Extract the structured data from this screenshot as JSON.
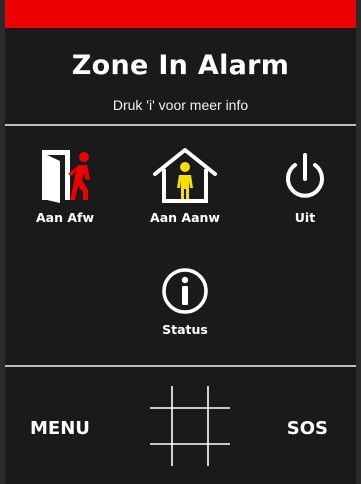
{
  "header": {
    "title": "Zone In Alarm",
    "subtitle": "Druk 'i' voor meer info",
    "alarm_color": "#ee0000"
  },
  "actions": [
    {
      "label": "Aan Afw",
      "icon": "door-walking-person-icon"
    },
    {
      "label": "Aan Aanw",
      "icon": "house-person-icon"
    },
    {
      "label": "Uit",
      "icon": "power-icon"
    },
    {
      "label": "Status",
      "icon": "info-icon"
    }
  ],
  "footer": {
    "menu_label": "MENU",
    "sos_label": "SOS",
    "keypad_icon": "keypad-grid-icon"
  },
  "colors": {
    "background": "#1a1a1a",
    "text": "#ffffff",
    "person_away": "#ee0000",
    "person_home": "#f5e000"
  }
}
